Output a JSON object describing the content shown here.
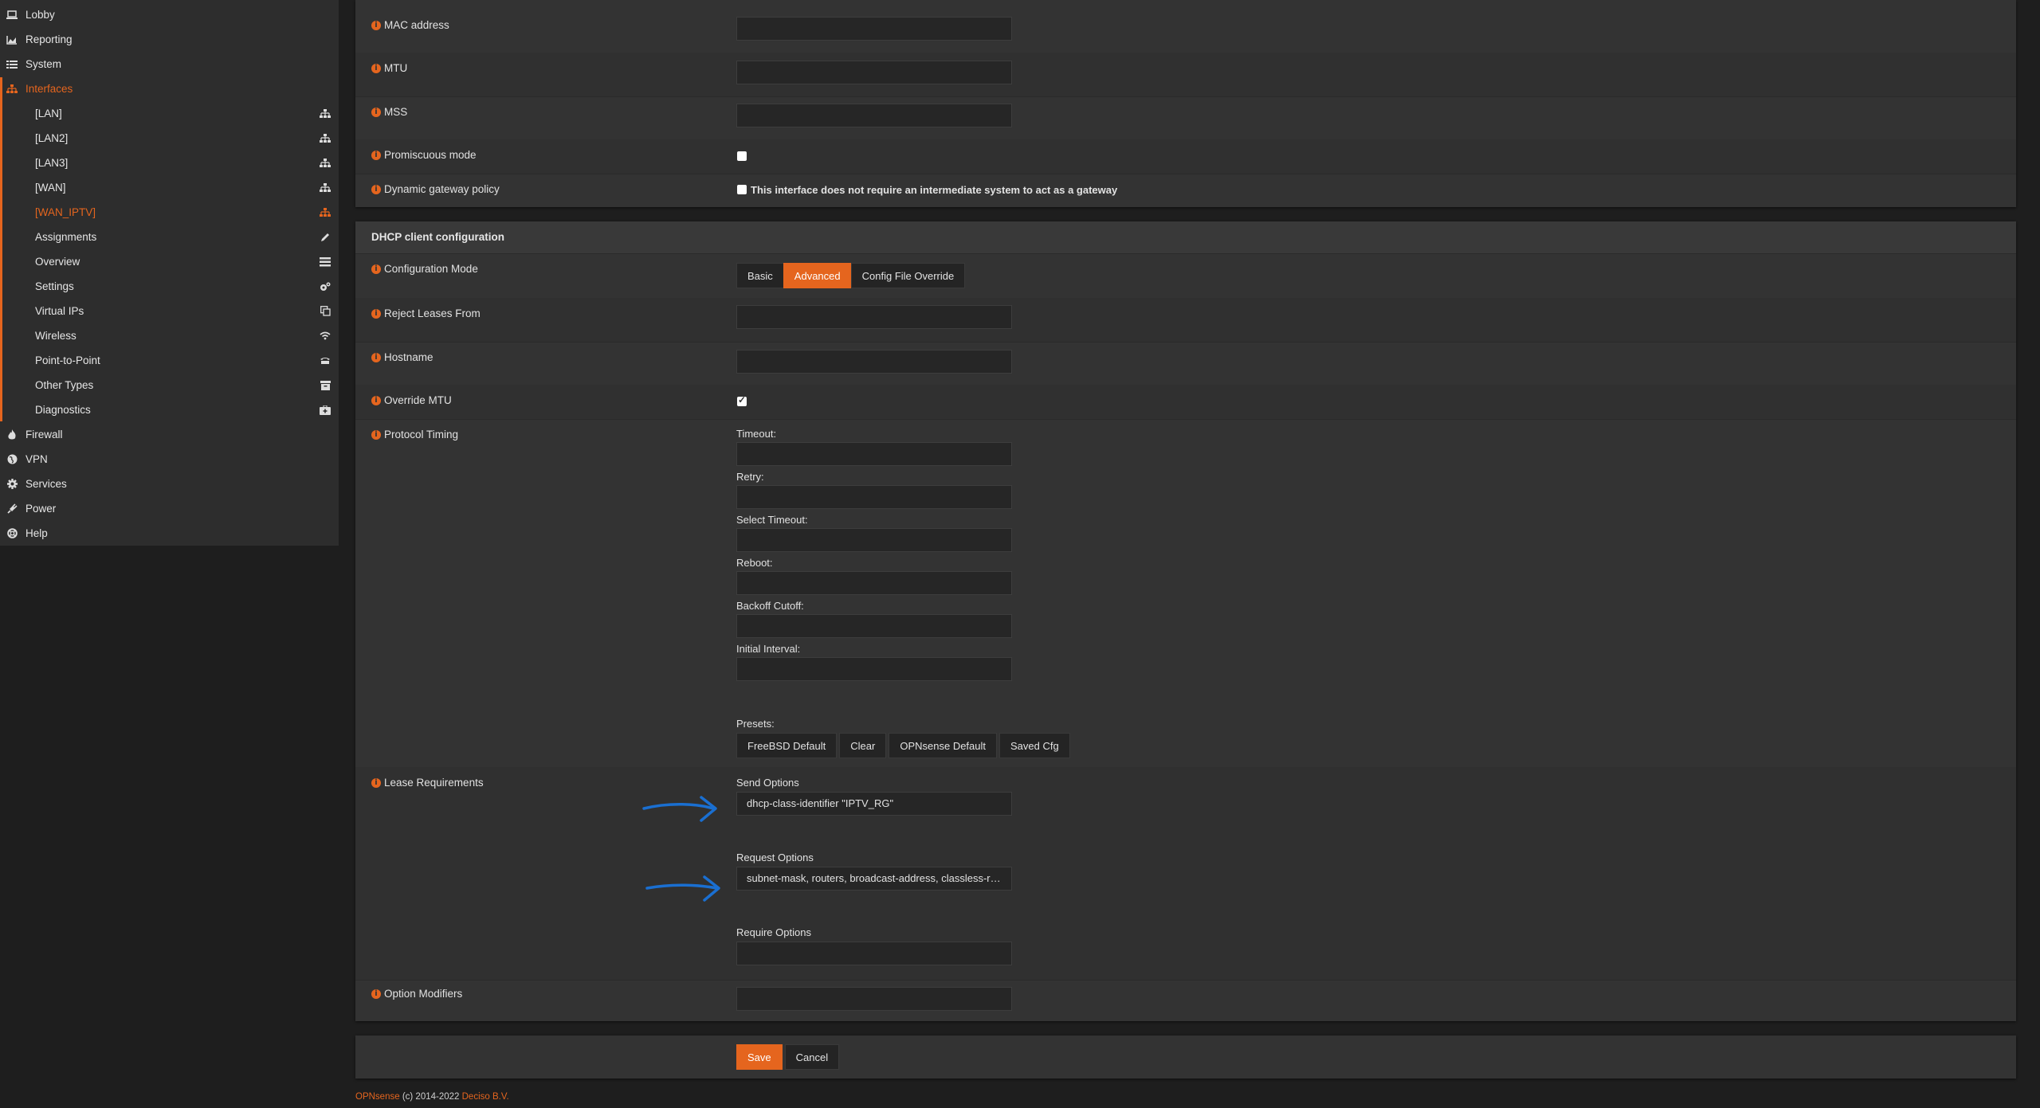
{
  "sidebar": {
    "top": [
      {
        "label": "Lobby",
        "icon": "laptop-icon"
      },
      {
        "label": "Reporting",
        "icon": "area-chart-icon"
      },
      {
        "label": "System",
        "icon": "list-icon"
      },
      {
        "label": "Interfaces",
        "icon": "sitemap-icon",
        "active": true
      }
    ],
    "interfaces_sub": [
      {
        "label": "[LAN]",
        "icon": "sitemap-icon"
      },
      {
        "label": "[LAN2]",
        "icon": "sitemap-icon"
      },
      {
        "label": "[LAN3]",
        "icon": "sitemap-icon"
      },
      {
        "label": "[WAN]",
        "icon": "sitemap-icon"
      },
      {
        "label": "[WAN_IPTV]",
        "icon": "sitemap-icon",
        "active": true
      },
      {
        "label": "Assignments",
        "icon": "pencil-icon"
      },
      {
        "label": "Overview",
        "icon": "tasks-icon"
      },
      {
        "label": "Settings",
        "icon": "cogs-icon"
      },
      {
        "label": "Virtual IPs",
        "icon": "clone-icon"
      },
      {
        "label": "Wireless",
        "icon": "wifi-icon"
      },
      {
        "label": "Point-to-Point",
        "icon": "tty-icon"
      },
      {
        "label": "Other Types",
        "icon": "archive-icon"
      },
      {
        "label": "Diagnostics",
        "icon": "medkit-icon"
      }
    ],
    "bottom": [
      {
        "label": "Firewall",
        "icon": "fire-icon"
      },
      {
        "label": "VPN",
        "icon": "globe-icon"
      },
      {
        "label": "Services",
        "icon": "cog-icon"
      },
      {
        "label": "Power",
        "icon": "plug-icon"
      },
      {
        "label": "Help",
        "icon": "life-ring-icon"
      }
    ]
  },
  "general": {
    "mac_address": {
      "label": "MAC address",
      "value": ""
    },
    "mtu": {
      "label": "MTU",
      "value": ""
    },
    "mss": {
      "label": "MSS",
      "value": ""
    },
    "promiscuous": {
      "label": "Promiscuous mode",
      "checked": false
    },
    "dynamic_gateway": {
      "label": "Dynamic gateway policy",
      "checked": false,
      "text": "This interface does not require an intermediate system to act as a gateway"
    }
  },
  "dhcp": {
    "title": "DHCP client configuration",
    "config_mode": {
      "label": "Configuration Mode",
      "options": [
        "Basic",
        "Advanced",
        "Config File Override"
      ],
      "selected": "Advanced"
    },
    "reject_leases": {
      "label": "Reject Leases From",
      "value": ""
    },
    "hostname": {
      "label": "Hostname",
      "value": ""
    },
    "override_mtu": {
      "label": "Override MTU",
      "checked": true
    },
    "protocol_timing": {
      "label": "Protocol Timing",
      "fields": [
        {
          "label": "Timeout:",
          "value": ""
        },
        {
          "label": "Retry:",
          "value": ""
        },
        {
          "label": "Select Timeout:",
          "value": ""
        },
        {
          "label": "Reboot:",
          "value": ""
        },
        {
          "label": "Backoff Cutoff:",
          "value": ""
        },
        {
          "label": "Initial Interval:",
          "value": ""
        }
      ],
      "presets_label": "Presets:",
      "presets": [
        "FreeBSD Default",
        "Clear",
        "OPNsense Default",
        "Saved Cfg"
      ]
    },
    "lease_requirements": {
      "label": "Lease Requirements",
      "send_options": {
        "label": "Send Options",
        "value": "dhcp-class-identifier \"IPTV_RG\""
      },
      "request_options": {
        "label": "Request Options",
        "value": "subnet-mask, routers, broadcast-address, classless-routes"
      },
      "require_options": {
        "label": "Require Options",
        "value": ""
      }
    },
    "option_modifiers": {
      "label": "Option Modifiers",
      "value": ""
    }
  },
  "actions": {
    "save": "Save",
    "cancel": "Cancel"
  },
  "footer": {
    "brand": "OPNsense",
    "copyright": "(c) 2014-2022",
    "company": "Deciso B.V."
  },
  "colors": {
    "accent": "#e5651e",
    "annotation_arrow": "#1a6fd1"
  }
}
